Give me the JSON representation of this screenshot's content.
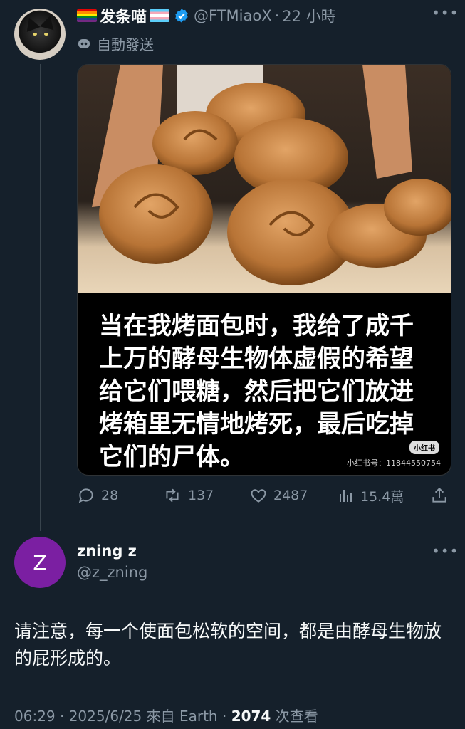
{
  "tweet": {
    "author": {
      "display_name": "发条喵",
      "handle": "@FTMiaoX",
      "time": "22 小時",
      "separator": "·",
      "flags": [
        "rainbow-flag-icon",
        "transgender-flag-icon"
      ]
    },
    "automated_label": "自動發送",
    "image_caption_lines": [
      "当在我烤面包时，我给了成千",
      "上万的酵母生物体虚假的希望",
      "给它们喂糖，然后把它们放进",
      "烤箱里无情地烤死，最后吃掉",
      "它们的尸体。"
    ],
    "watermark_logo": "小红书",
    "watermark_id": "小红书号：11844550754",
    "stats": {
      "replies": "28",
      "retweets": "137",
      "likes": "2487",
      "views": "15.4萬"
    }
  },
  "reply": {
    "avatar_letter": "Z",
    "display_name": "zning z",
    "handle": "@z_zning",
    "text": "请注意，每一个使面包松软的空间，都是由酵母生物放的屁形成的。",
    "meta_time": "06:29 · 2025/6/25 來自 Earth · ",
    "meta_views": "2074",
    "meta_views_suffix": " 次查看"
  },
  "colors": {
    "background": "#15202b",
    "text_primary": "#f7f9f9",
    "text_secondary": "#8b98a5",
    "verified": "#1d9bf0",
    "reply_avatar": "#7b1fa2"
  }
}
